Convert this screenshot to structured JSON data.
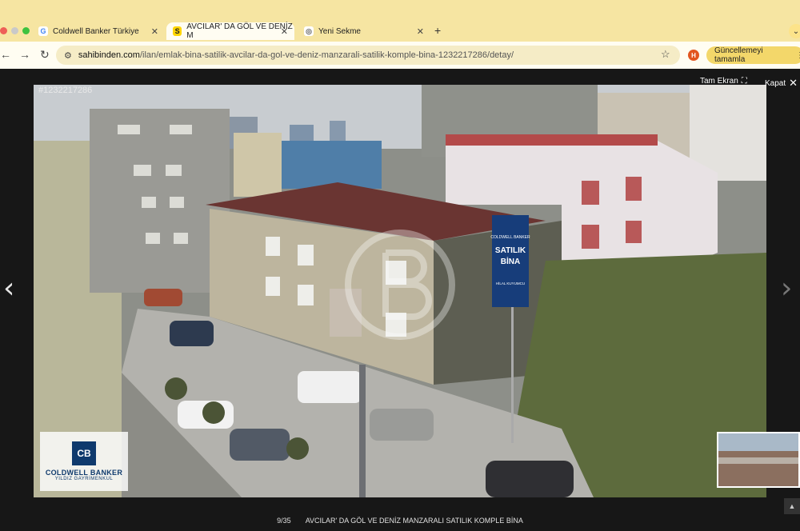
{
  "browser": {
    "tabs": [
      {
        "label": "Coldwell Banker Türkiye",
        "favicon": "google-g-icon",
        "active": false
      },
      {
        "label": "AVCILAR' DA GÖL VE DENİZ M",
        "favicon": "sahibinden-s-icon",
        "active": true
      },
      {
        "label": "Yeni Sekme",
        "favicon": "chrome-icon",
        "active": false
      }
    ],
    "url_host": "sahibinden.com",
    "url_path": "/ilan/emlak-bina-satilik-avcilar-da-gol-ve-deniz-manzarali-satilik-komple-bina-1232217286/detay/",
    "update_label": "Güncellemeyi tamamla",
    "extension_badge": "H"
  },
  "gallery": {
    "listing_id": "#1232217286",
    "fullscreen_label": "Tam Ekran",
    "close_label": "Kapat",
    "counter": "9/35",
    "title": "AVCILAR' DA GÖL VE DENİZ MANZARALI SATILIK KOMPLE BİNA"
  },
  "sign": {
    "brand": "COLDWELL BANKER",
    "headline_1": "SATILIK",
    "headline_2": "BİNA",
    "agent": "HİLAL KUYUMCU"
  },
  "logo": {
    "mark": "CB",
    "name": "COLDWELL BANKER",
    "sub": "YILDIZ GAYRİMENKUL"
  },
  "colors": {
    "tabbar": "#f6e5a2",
    "toolbar": "#fffdf2",
    "brand_blue": "#0f3a6d"
  }
}
